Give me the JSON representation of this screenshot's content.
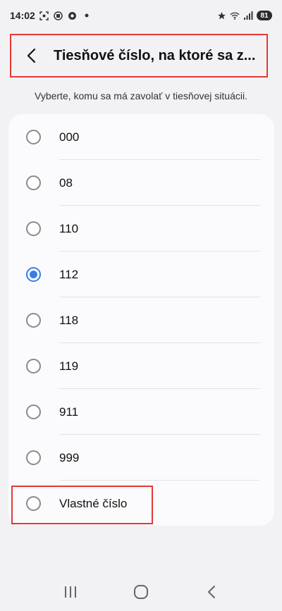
{
  "status_bar": {
    "time": "14:02",
    "battery": "81",
    "left_icons": [
      "screenshot-icon",
      "recorder-icon",
      "chrome-icon",
      "dot-icon"
    ],
    "right_icons": [
      "star-icon",
      "wifi-icon",
      "signal-icon",
      "battery-icon"
    ]
  },
  "header": {
    "title": "Tiesňové číslo, na ktoré sa z...",
    "back_icon": "back-arrow-icon"
  },
  "subtitle": "Vyberte, komu sa má zavolať v tiesňovej situácii.",
  "options": [
    {
      "label": "000",
      "selected": false
    },
    {
      "label": "08",
      "selected": false
    },
    {
      "label": "110",
      "selected": false
    },
    {
      "label": "112",
      "selected": true
    },
    {
      "label": "118",
      "selected": false
    },
    {
      "label": "119",
      "selected": false
    },
    {
      "label": "911",
      "selected": false
    },
    {
      "label": "999",
      "selected": false
    },
    {
      "label": "Vlastné číslo",
      "selected": false
    }
  ],
  "colors": {
    "accent": "#3b7de0",
    "highlight_border": "#e53935",
    "background": "#f2f2f4",
    "card": "#fbfbfd"
  },
  "nav_bar": {
    "icons": [
      "recents-icon",
      "home-icon",
      "back-icon"
    ]
  }
}
